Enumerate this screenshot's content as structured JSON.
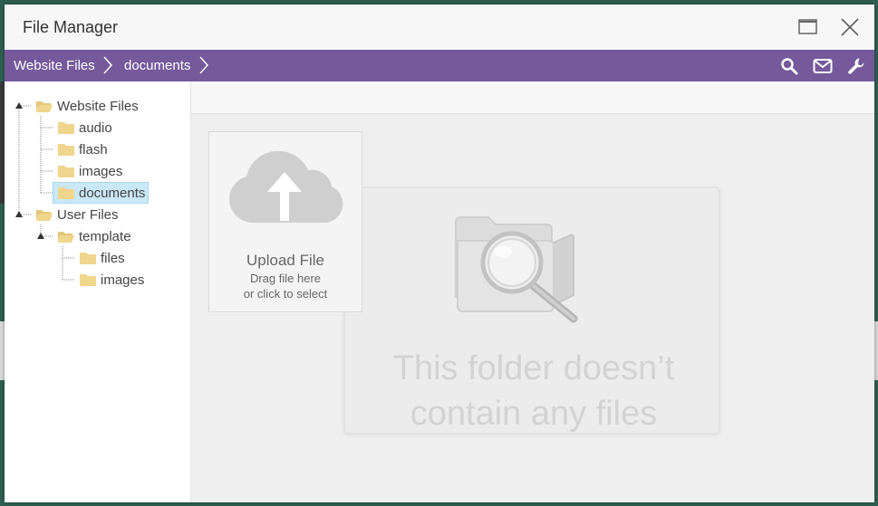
{
  "window": {
    "title": "File Manager",
    "maximize_icon": "maximize-icon",
    "close_icon": "close-icon"
  },
  "breadcrumb": {
    "items": [
      "Website Files",
      "documents"
    ],
    "separator_icon": "chevron-right-icon"
  },
  "toolbar": {
    "icons": [
      "search-icon",
      "mail-icon",
      "wrench-icon"
    ]
  },
  "tree": {
    "items": [
      {
        "label": "Website Files",
        "icon": "folder-open-icon"
      },
      {
        "label": "audio",
        "icon": "folder-icon"
      },
      {
        "label": "flash",
        "icon": "folder-icon"
      },
      {
        "label": "images",
        "icon": "folder-icon"
      },
      {
        "label": "documents",
        "icon": "folder-icon",
        "selected": true
      },
      {
        "label": "User Files",
        "icon": "folder-open-icon"
      },
      {
        "label": "template",
        "icon": "folder-open-icon"
      },
      {
        "label": "files",
        "icon": "folder-icon"
      },
      {
        "label": "images",
        "icon": "folder-icon"
      }
    ]
  },
  "upload": {
    "title": "Upload File",
    "line1": "Drag file here",
    "line2": "or click to select",
    "icon": "cloud-upload-icon"
  },
  "empty": {
    "line1": "This folder doesn’t",
    "line2": "contain any files",
    "icon": "folder-magnifier-icon"
  },
  "colors": {
    "header": "#75599b",
    "selected": "#c9e8f8",
    "folder": "#f0d58c"
  }
}
